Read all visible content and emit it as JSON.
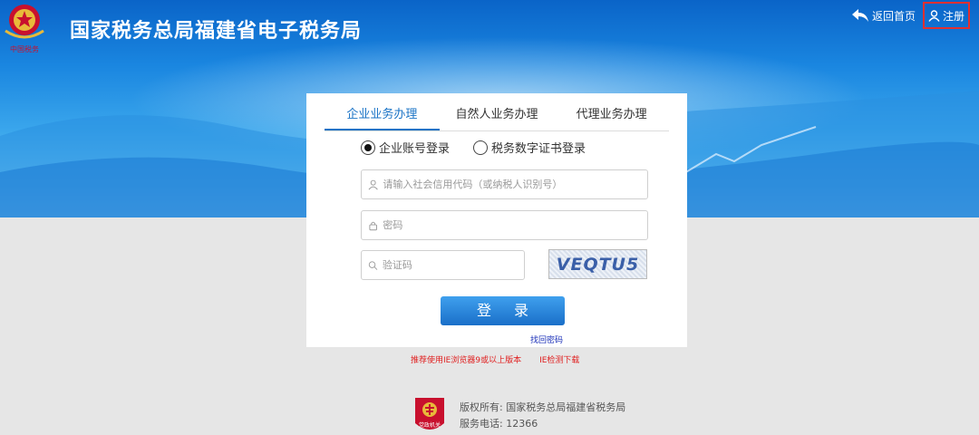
{
  "header": {
    "title": "国家税务总局福建省电子税务局",
    "emblem_caption": "中国税务",
    "home_link": "返回首页",
    "register_link": "注册"
  },
  "login": {
    "tabs": [
      {
        "label": "企业业务办理",
        "active": true
      },
      {
        "label": "自然人业务办理",
        "active": false
      },
      {
        "label": "代理业务办理",
        "active": false
      }
    ],
    "modes": [
      {
        "label": "企业账号登录",
        "selected": true
      },
      {
        "label": "税务数字证书登录",
        "selected": false
      }
    ],
    "account_placeholder": "请输入社会信用代码（或纳税人识别号）",
    "password_placeholder": "密码",
    "captcha_placeholder": "验证码",
    "captcha_text": "VEQTU5",
    "submit_label": "登 录",
    "forgot_label": "找回密码"
  },
  "notice": {
    "browser_tip": "推荐使用IE浏览器9或以上版本",
    "ie_check": "IE检测下载"
  },
  "footer": {
    "copyright": "版权所有: 国家税务总局福建省税务局",
    "phone": "服务电话: 12366",
    "badge_text": "党政机关"
  },
  "colors": {
    "accent": "#1a73c6",
    "banner": "#1a86e0",
    "alert": "#e02020",
    "register_border": "#e23030"
  }
}
